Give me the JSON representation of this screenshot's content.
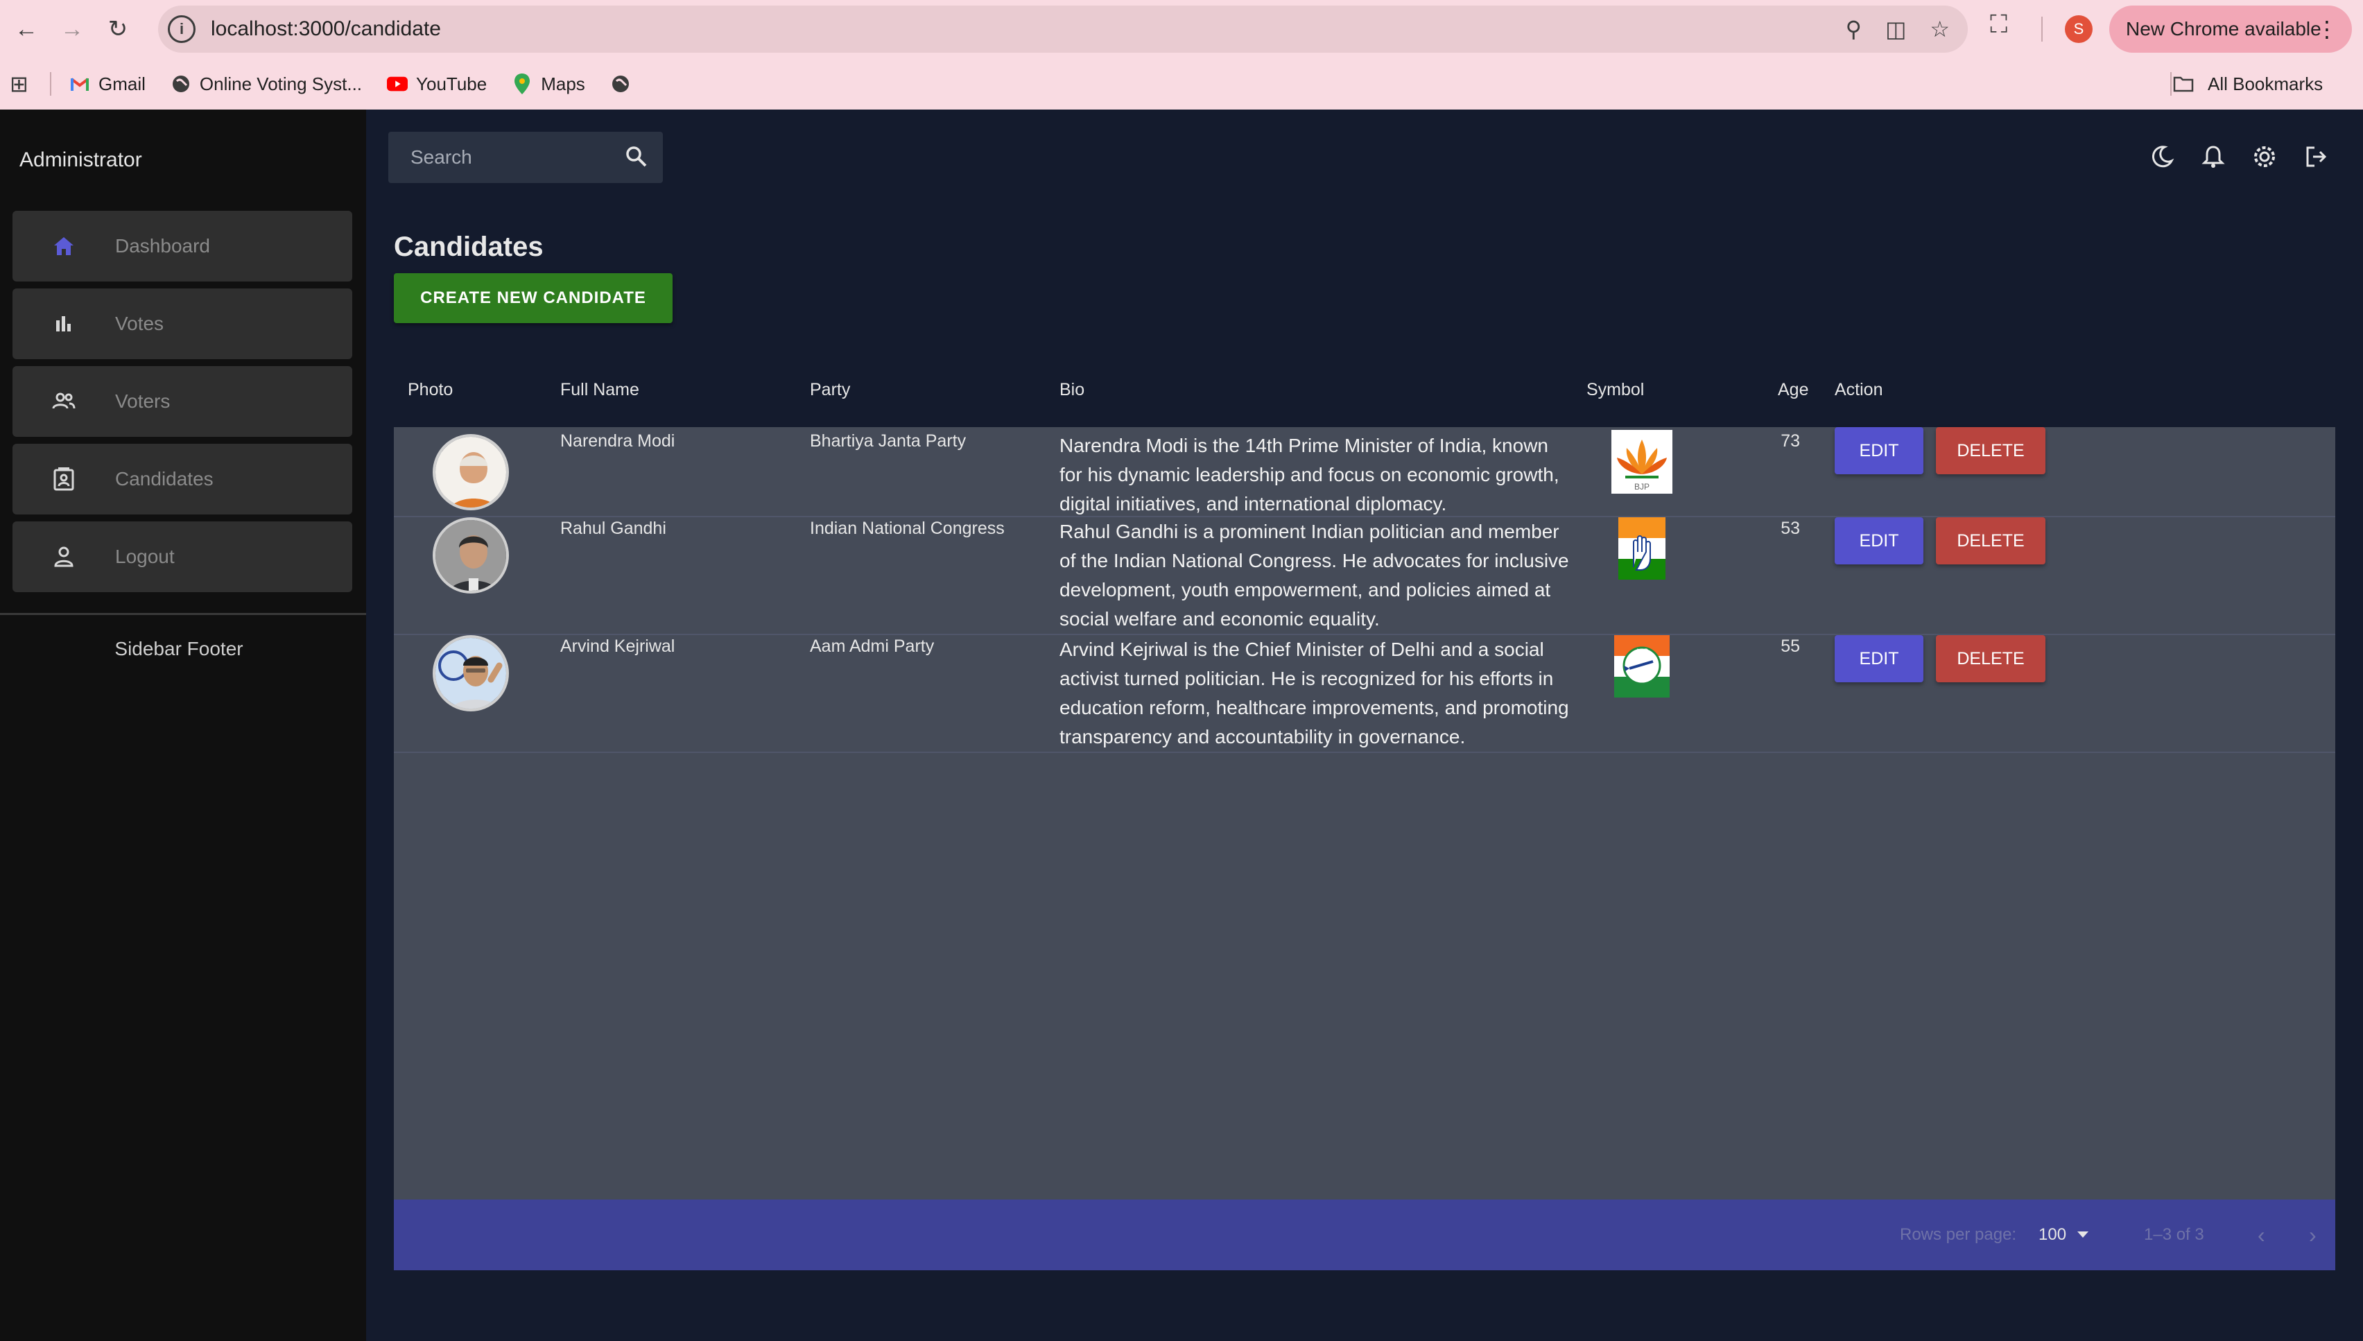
{
  "browser": {
    "url": "localhost:3000/candidate",
    "update_label": "New Chrome available",
    "profile_initial": "S",
    "bookmarks": [
      {
        "label": "Gmail"
      },
      {
        "label": "Online Voting Syst..."
      },
      {
        "label": "YouTube"
      },
      {
        "label": "Maps"
      }
    ],
    "all_bookmarks": "All Bookmarks"
  },
  "sidebar": {
    "title": "Administrator",
    "items": [
      {
        "label": "Dashboard",
        "icon": "home-icon"
      },
      {
        "label": "Votes",
        "icon": "bar-chart-icon"
      },
      {
        "label": "Voters",
        "icon": "people-icon"
      },
      {
        "label": "Candidates",
        "icon": "contact-card-icon"
      },
      {
        "label": "Logout",
        "icon": "person-icon"
      }
    ],
    "footer": "Sidebar Footer"
  },
  "topbar": {
    "search_placeholder": "Search"
  },
  "page": {
    "title": "Candidates",
    "create_button": "CREATE NEW CANDIDATE"
  },
  "table": {
    "columns": [
      "Photo",
      "Full Name",
      "Party",
      "Bio",
      "Symbol",
      "Age",
      "Action"
    ],
    "edit_label": "EDIT",
    "delete_label": "DELETE",
    "rows": [
      {
        "name": "Narendra Modi",
        "party": "Bhartiya Janta Party",
        "bio": "Narendra Modi is the 14th Prime Minister of India, known for his dynamic leadership and focus on economic growth, digital initiatives, and international diplomacy.",
        "age": "73",
        "symbol": "lotus-symbol"
      },
      {
        "name": "Rahul Gandhi",
        "party": "Indian National Congress",
        "bio": "Rahul Gandhi is a prominent Indian politician and member of the Indian National Congress. He advocates for inclusive development, youth empowerment, and policies aimed at social welfare and economic equality.",
        "age": "53",
        "symbol": "hand-symbol"
      },
      {
        "name": "Arvind Kejriwal",
        "party": "Aam Admi Party",
        "bio": "Arvind Kejriwal is the Chief Minister of Delhi and a social activist turned politician. He is recognized for his efforts in education reform, healthcare improvements, and promoting transparency and accountability in governance.",
        "age": "55",
        "symbol": "broom-symbol"
      }
    ],
    "footer": {
      "rows_per_page_label": "Rows per page:",
      "rows_per_page_value": "100",
      "range": "1–3 of 3"
    }
  },
  "colors": {
    "sidebar_bg": "#101010",
    "main_bg": "#141b2d",
    "table_bg": "#454b58",
    "footer_bg": "#3e4297",
    "create_green": "#2e7d1e",
    "edit_blue": "#5451cc",
    "delete_red": "#b8443e"
  }
}
